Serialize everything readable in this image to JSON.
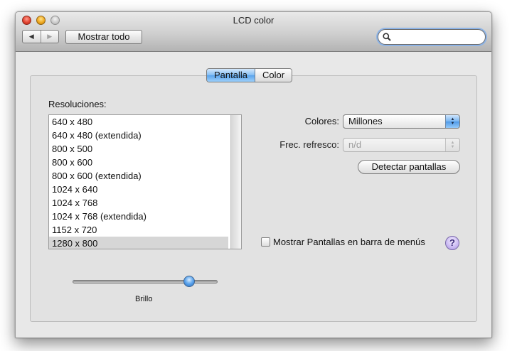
{
  "window": {
    "title": "LCD color"
  },
  "toolbar": {
    "back_glyph": "◀",
    "forward_glyph": "▶",
    "show_all_label": "Mostrar todo",
    "search_value": ""
  },
  "tabs": [
    {
      "label": "Pantalla",
      "selected": true
    },
    {
      "label": "Color",
      "selected": false
    }
  ],
  "resolutions": {
    "label": "Resoluciones:",
    "items": [
      {
        "label": "640 x 480",
        "selected": false
      },
      {
        "label": "640 x 480 (extendida)",
        "selected": false
      },
      {
        "label": "800 x 500",
        "selected": false
      },
      {
        "label": "800 x 600",
        "selected": false
      },
      {
        "label": "800 x 600 (extendida)",
        "selected": false
      },
      {
        "label": "1024 x 640",
        "selected": false
      },
      {
        "label": "1024 x 768",
        "selected": false
      },
      {
        "label": "1024 x 768 (extendida)",
        "selected": false
      },
      {
        "label": "1152 x 720",
        "selected": false
      },
      {
        "label": "1280 x 800",
        "selected": true
      }
    ]
  },
  "settings": {
    "colors_label": "Colores:",
    "colors_value": "Millones",
    "refresh_label": "Frec. refresco:",
    "refresh_value": "n/d",
    "detect_label": "Detectar pantallas",
    "show_menu_label": "Mostrar Pantallas en barra de menús",
    "show_menu_checked": false,
    "help_glyph": "?"
  },
  "brightness": {
    "label": "Brillo",
    "level": 0.82
  },
  "colors": {
    "selection_blue": "#5aa3ec",
    "window_bg": "#e8e8e8",
    "close": "#e2432f",
    "minimize": "#f0a920",
    "zoom": "#c9c9c9"
  }
}
